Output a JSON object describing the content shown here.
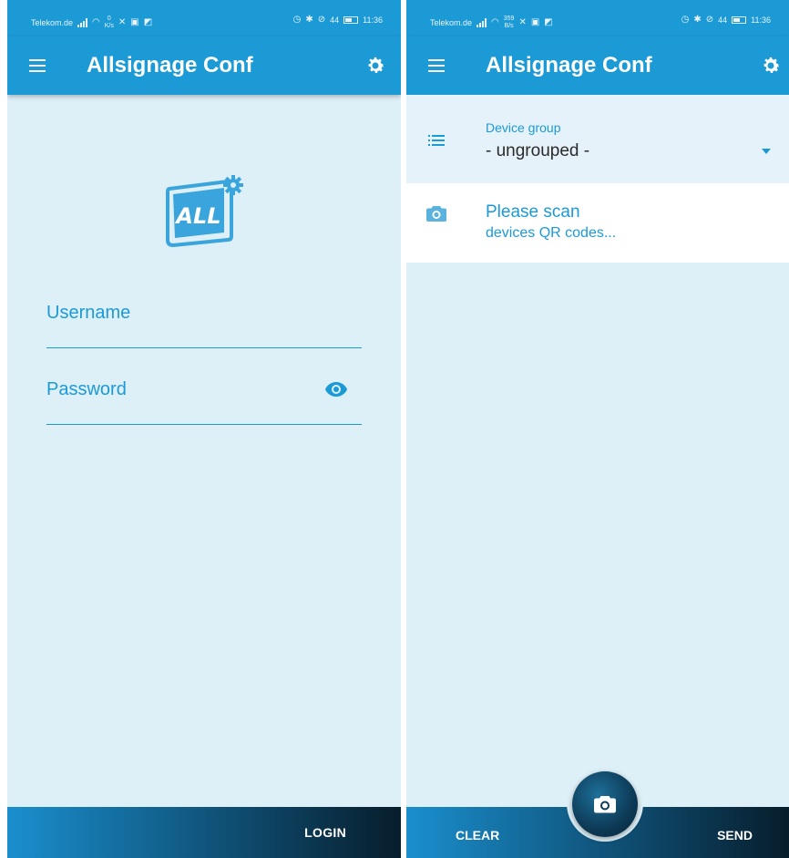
{
  "colors": {
    "primary": "#1c9ad6",
    "background": "#ddeff7",
    "bar_dark": "#071d2b"
  },
  "login_screen": {
    "status_bar": {
      "carrier": "Telekom.de",
      "speed": "0",
      "speed_unit": "K/s",
      "battery": "44",
      "time": "11:36"
    },
    "app_bar": {
      "title": "Allsignage Conf",
      "menu_icon": "menu-icon",
      "settings_icon": "gear-icon"
    },
    "logo": {
      "text": "ALL"
    },
    "username": {
      "label": "Username"
    },
    "password": {
      "label": "Password",
      "icon": "eye-icon"
    },
    "bottom_bar": {
      "login_label": "LOGIN"
    }
  },
  "scan_screen": {
    "status_bar": {
      "carrier": "Telekom.de",
      "speed": "359",
      "speed_unit": "B/s",
      "battery": "44",
      "time": "11:36"
    },
    "app_bar": {
      "title": "Allsignage Conf",
      "menu_icon": "menu-icon",
      "settings_icon": "gear-icon"
    },
    "device_group": {
      "label": "Device group",
      "value": "- ungrouped -",
      "icon": "list-icon"
    },
    "scan_prompt": {
      "line1": "Please scan",
      "line2": "devices QR codes...",
      "icon": "camera-icon"
    },
    "bottom_bar": {
      "clear_label": "CLEAR",
      "send_label": "SEND",
      "fab_icon": "camera-icon"
    }
  }
}
